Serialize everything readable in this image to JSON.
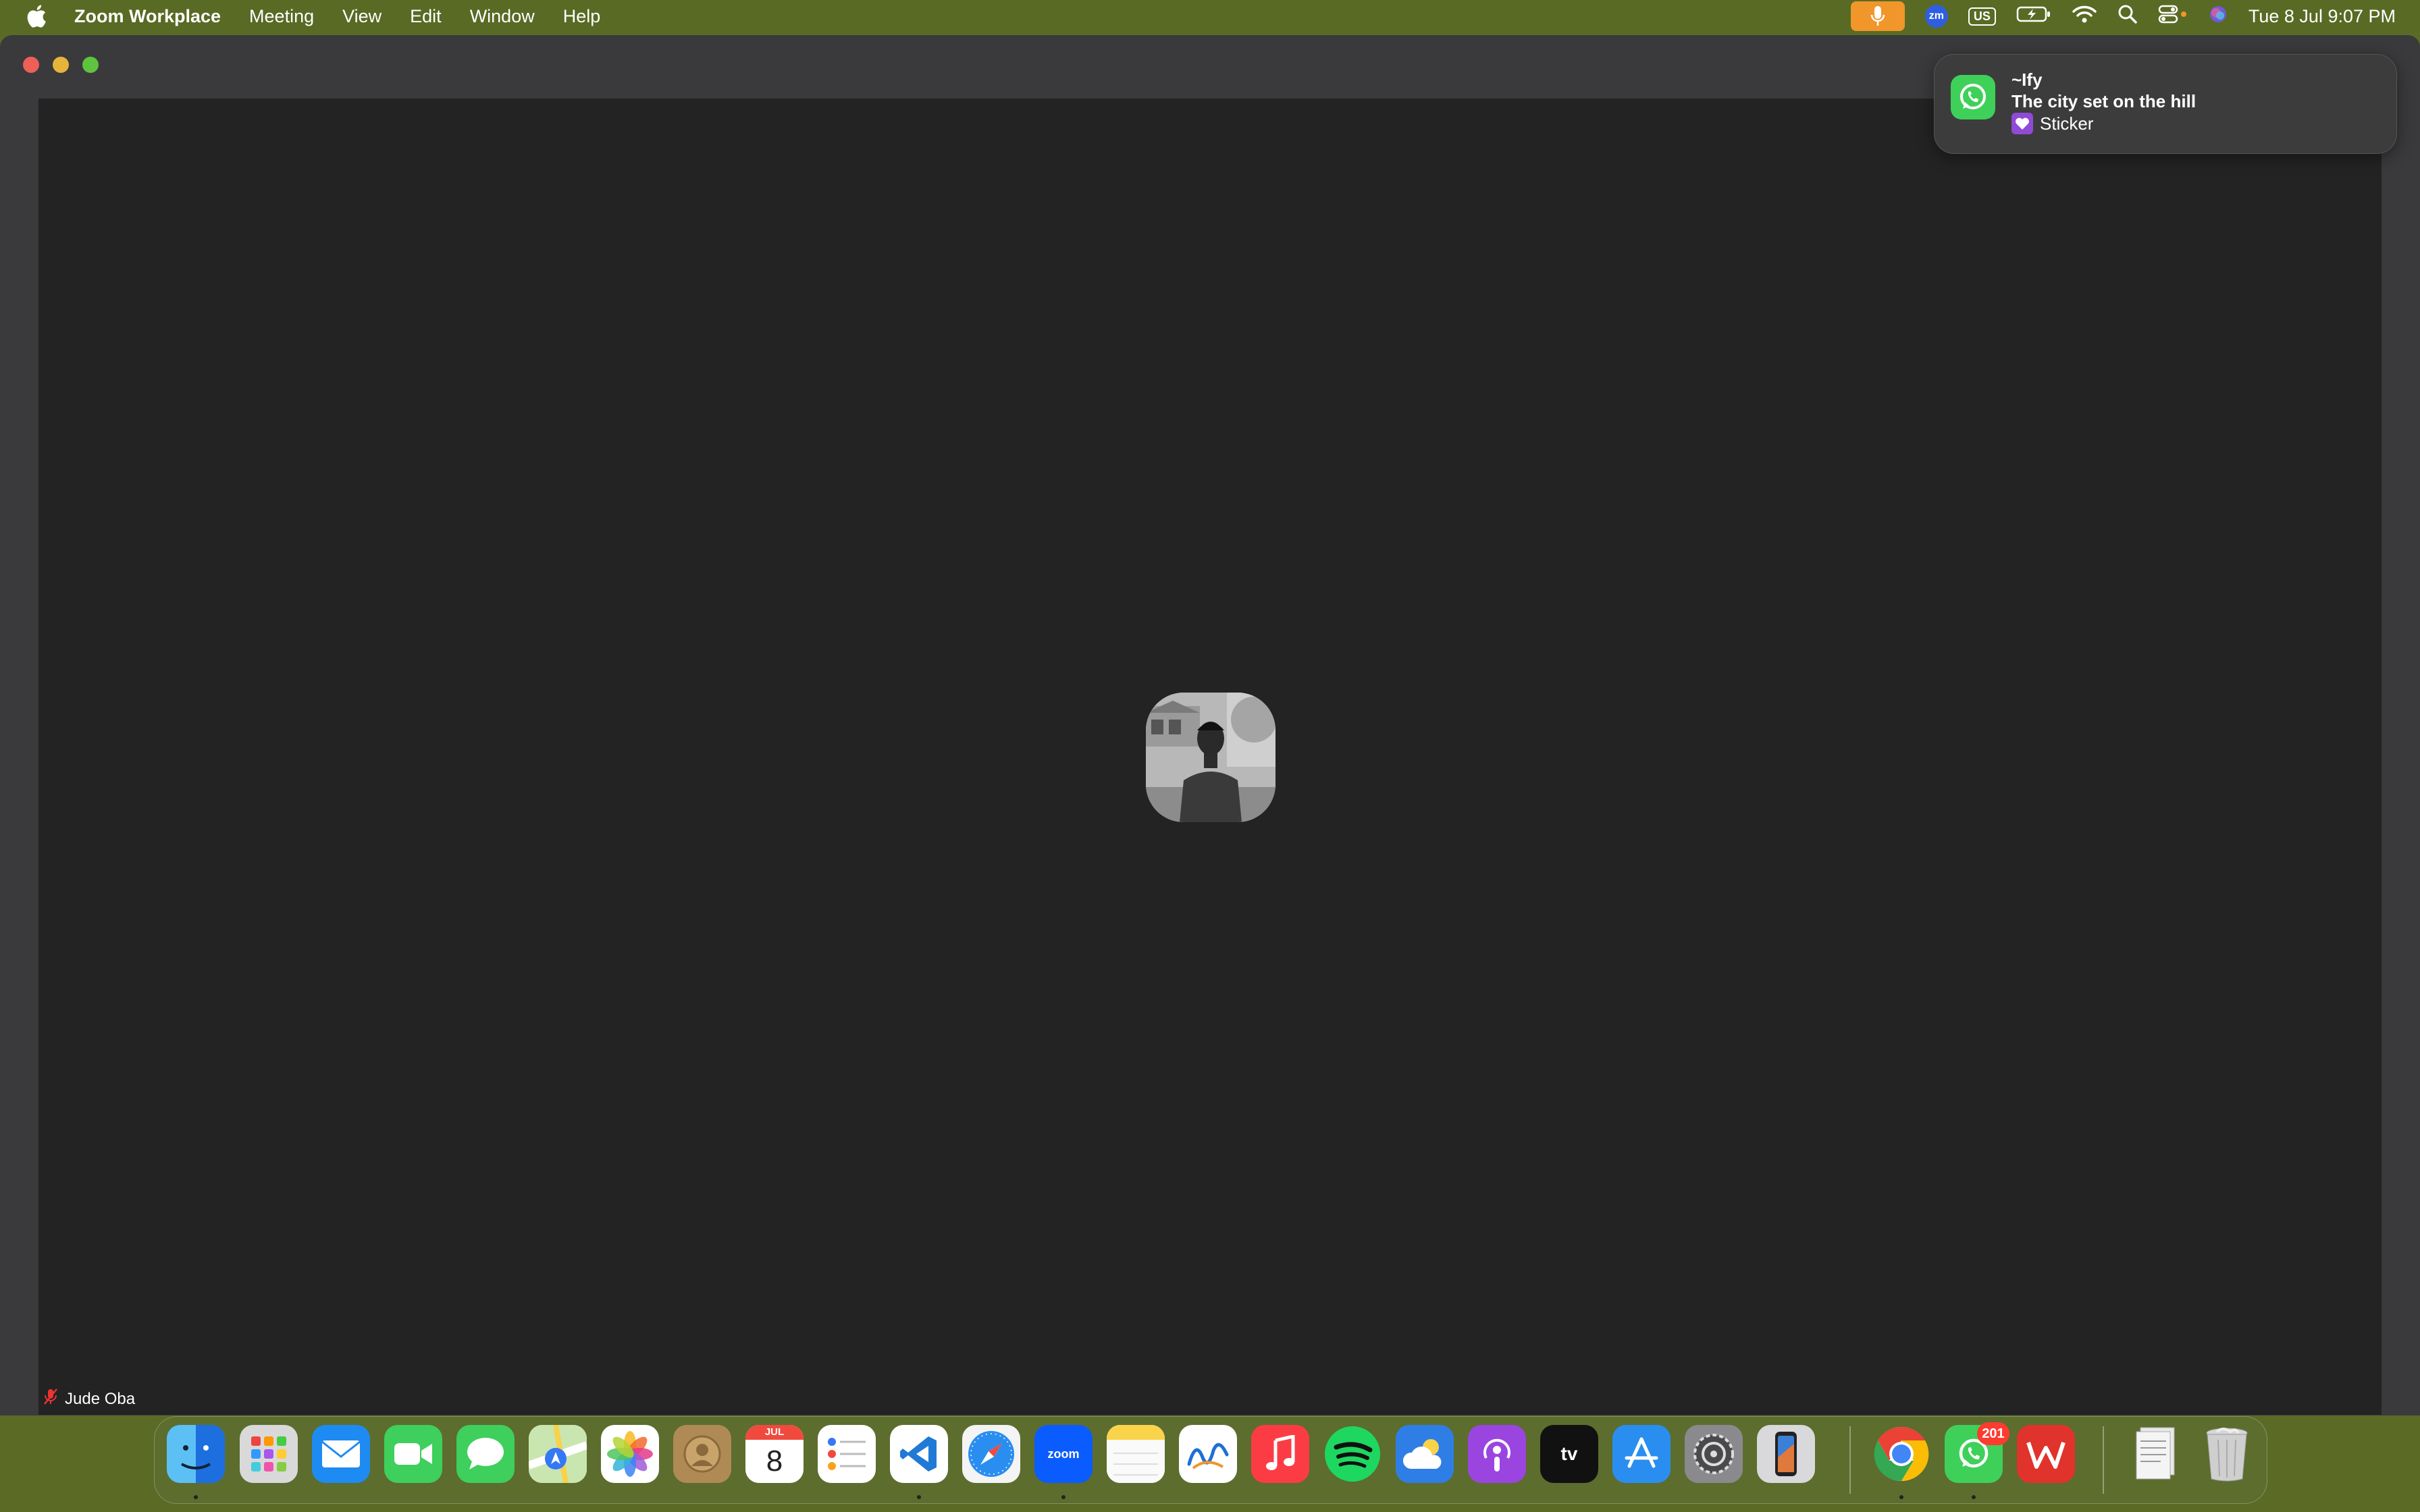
{
  "menubar": {
    "app_name": "Zoom Workplace",
    "items": [
      "Meeting",
      "View",
      "Edit",
      "Window",
      "Help"
    ],
    "status_icons": [
      "microphone-icon",
      "zoom-status-icon",
      "keyboard-layout-icon",
      "battery-charging-icon",
      "wifi-icon",
      "spotlight-icon",
      "control-center-icon",
      "siri-icon"
    ],
    "zoom_badge": "zm",
    "keyboard_layout": "US",
    "clock": "Tue 8 Jul  9:07 PM"
  },
  "meeting": {
    "participant_name": "Jude Oba",
    "participant_muted": true
  },
  "notification": {
    "app_icon": "whatsapp-icon",
    "title": "~Ify",
    "subtitle": "The city set on the hill",
    "body": "Sticker",
    "body_icon": "heart-icon"
  },
  "dock": {
    "apps": [
      {
        "name": "Finder",
        "icon": "finder-icon",
        "running": true
      },
      {
        "name": "Launchpad",
        "icon": "launchpad-icon",
        "running": false
      },
      {
        "name": "Mail",
        "icon": "mail-icon",
        "running": false
      },
      {
        "name": "FaceTime",
        "icon": "facetime-icon",
        "running": false
      },
      {
        "name": "Messages",
        "icon": "messages-icon",
        "running": false
      },
      {
        "name": "Maps",
        "icon": "maps-icon",
        "running": false
      },
      {
        "name": "Photos",
        "icon": "photos-icon",
        "running": false
      },
      {
        "name": "Contacts",
        "icon": "contacts-icon",
        "running": false
      },
      {
        "name": "Calendar",
        "icon": "calendar-icon",
        "running": false,
        "month": "JUL",
        "day": "8"
      },
      {
        "name": "Reminders",
        "icon": "reminders-icon",
        "running": false
      },
      {
        "name": "Visual Studio Code",
        "icon": "vscode-icon",
        "running": true
      },
      {
        "name": "Safari",
        "icon": "safari-icon",
        "running": false
      },
      {
        "name": "Zoom",
        "icon": "zoom-icon",
        "running": true,
        "label": "zoom"
      },
      {
        "name": "Notes",
        "icon": "notes-icon",
        "running": false
      },
      {
        "name": "Freeform",
        "icon": "freeform-icon",
        "running": false
      },
      {
        "name": "Music",
        "icon": "music-icon",
        "running": false
      },
      {
        "name": "Spotify",
        "icon": "spotify-icon",
        "running": false
      },
      {
        "name": "Weather",
        "icon": "weather-icon",
        "running": false
      },
      {
        "name": "Podcasts",
        "icon": "podcasts-icon",
        "running": false
      },
      {
        "name": "TV",
        "icon": "apple-tv-icon",
        "running": false,
        "label": "tv"
      },
      {
        "name": "App Store",
        "icon": "app-store-icon",
        "running": false
      },
      {
        "name": "System Settings",
        "icon": "settings-icon",
        "running": false
      },
      {
        "name": "iPhone Mirroring",
        "icon": "iphone-mirroring-icon",
        "running": false
      },
      {
        "name": "Google Chrome",
        "icon": "chrome-icon",
        "running": true
      },
      {
        "name": "WhatsApp",
        "icon": "whatsapp-icon",
        "running": true,
        "badge": "201"
      },
      {
        "name": "WPS Office",
        "icon": "wps-icon",
        "running": false
      },
      {
        "name": "Documents",
        "icon": "documents-stack-icon",
        "running": false
      },
      {
        "name": "Trash",
        "icon": "trash-icon",
        "running": false
      }
    ]
  },
  "colors": {
    "menubar": "#596a24",
    "window_bg": "#3a3a3c",
    "stage_bg": "#232323",
    "mic_active": "#f0962a",
    "whatsapp": "#3fd05a",
    "badge": "#ff3b30"
  }
}
